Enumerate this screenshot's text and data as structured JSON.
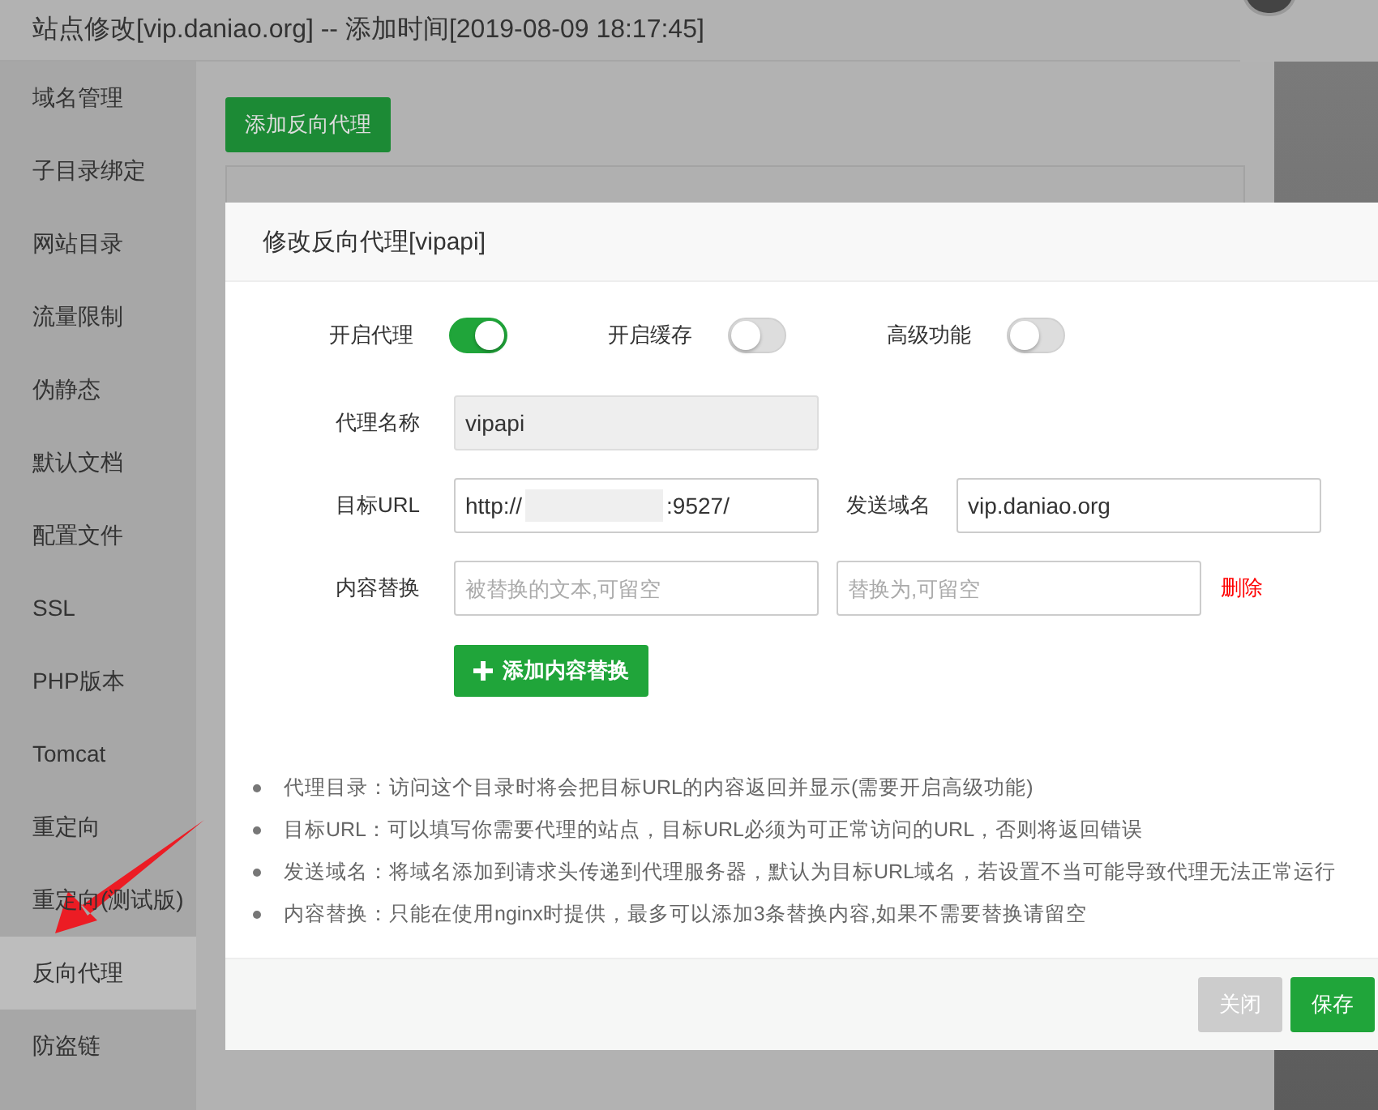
{
  "dialog_title": "站点修改[vip.daniao.org] -- 添加时间[2019-08-09 18:17:45]",
  "sidebar": {
    "items": [
      {
        "label": "域名管理",
        "selected": false
      },
      {
        "label": "子目录绑定",
        "selected": false
      },
      {
        "label": "网站目录",
        "selected": false
      },
      {
        "label": "流量限制",
        "selected": false
      },
      {
        "label": "伪静态",
        "selected": false
      },
      {
        "label": "默认文档",
        "selected": false
      },
      {
        "label": "配置文件",
        "selected": false
      },
      {
        "label": "SSL",
        "selected": false
      },
      {
        "label": "PHP版本",
        "selected": false
      },
      {
        "label": "Tomcat",
        "selected": false
      },
      {
        "label": "重定向",
        "selected": false
      },
      {
        "label": "重定向(测试版)",
        "selected": false
      },
      {
        "label": "反向代理",
        "selected": true
      },
      {
        "label": "防盗链",
        "selected": false
      }
    ]
  },
  "add_proxy_button": "添加反向代理",
  "modal": {
    "title": "修改反向代理[vipapi]",
    "toggles": [
      {
        "label": "开启代理",
        "on": true
      },
      {
        "label": "开启缓存",
        "on": false
      },
      {
        "label": "高级功能",
        "on": false
      }
    ],
    "name_field": {
      "label": "代理名称",
      "value": "vipapi",
      "disabled": true
    },
    "target_url": {
      "label": "目标URL",
      "value_start": "http://",
      "value_end": ":9527/"
    },
    "send_domain": {
      "label": "发送域名",
      "value": "vip.daniao.org"
    },
    "content_replace": {
      "label": "内容替换",
      "from_placeholder": "被替换的文本,可留空",
      "to_placeholder": "替换为,可留空",
      "delete_link": "删除"
    },
    "add_replace_button": "添加内容替换",
    "notes": [
      "代理目录：访问这个目录时将会把目标URL的内容返回并显示(需要开启高级功能)",
      "目标URL：可以填写你需要代理的站点，目标URL必须为可正常访问的URL，否则将返回错误",
      "发送域名：将域名添加到请求头传递到代理服务器，默认为目标URL域名，若设置不当可能导致代理无法正常运行",
      "内容替换：只能在使用nginx时提供，最多可以添加3条替换内容,如果不需要替换请留空"
    ],
    "buttons": [
      {
        "label": "关闭",
        "kind": "disabled"
      },
      {
        "label": "保存",
        "kind": "primary"
      }
    ]
  }
}
